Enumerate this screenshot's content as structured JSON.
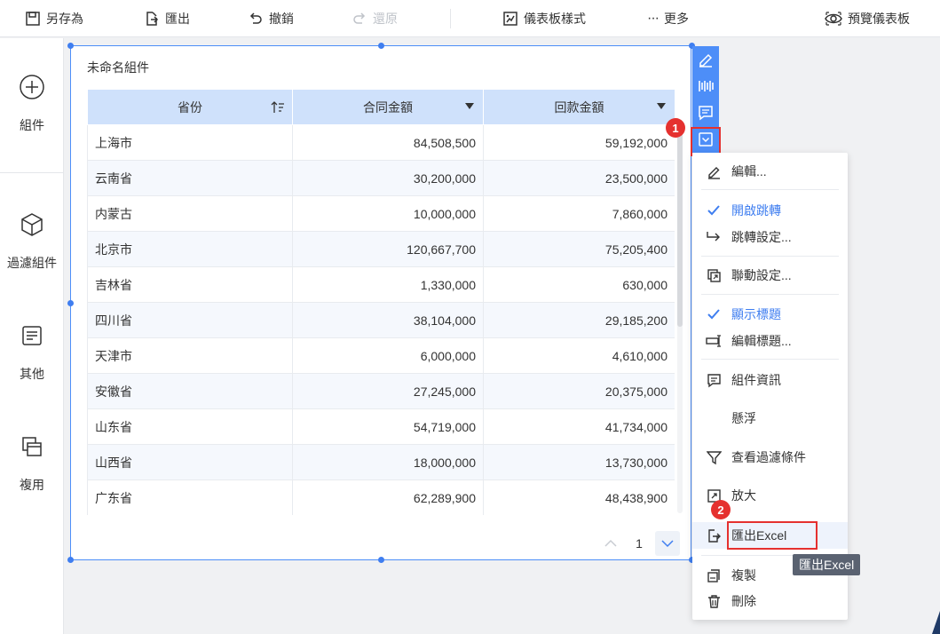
{
  "toolbar": {
    "save_as": "另存為",
    "export": "匯出",
    "undo": "撤銷",
    "redo": "還原",
    "dashboard_style": "儀表板樣式",
    "more": "更多",
    "preview": "預覽儀表板"
  },
  "sidebar": {
    "items": [
      {
        "label": "組件",
        "icon": "plus-circle-icon"
      },
      {
        "label": "過濾組件",
        "icon": "cube-icon"
      },
      {
        "label": "其他",
        "icon": "document-icon"
      },
      {
        "label": "複用",
        "icon": "copy-icon"
      }
    ]
  },
  "widget": {
    "title": "未命名組件",
    "columns": [
      "省份",
      "合同金額",
      "回款金額"
    ],
    "rows": [
      [
        "上海市",
        "84,508,500",
        "59,192,000"
      ],
      [
        "云南省",
        "30,200,000",
        "23,500,000"
      ],
      [
        "内蒙古",
        "10,000,000",
        "7,860,000"
      ],
      [
        "北京市",
        "120,667,700",
        "75,205,400"
      ],
      [
        "吉林省",
        "1,330,000",
        "630,000"
      ],
      [
        "四川省",
        "38,104,000",
        "29,185,200"
      ],
      [
        "天津市",
        "6,000,000",
        "4,610,000"
      ],
      [
        "安徽省",
        "27,245,000",
        "20,375,000"
      ],
      [
        "山东省",
        "54,719,000",
        "41,734,000"
      ],
      [
        "山西省",
        "18,000,000",
        "13,730,000"
      ],
      [
        "广东省",
        "62,289,900",
        "48,438,900"
      ]
    ],
    "page": "1"
  },
  "markers": {
    "one": "1",
    "two": "2"
  },
  "menu": {
    "edit": "編輯...",
    "enable_jump": "開啟跳轉",
    "jump_settings": "跳轉設定...",
    "linkage_settings": "聯動設定...",
    "show_title": "顯示標題",
    "edit_title": "編輯標題...",
    "widget_info": "組件資訊",
    "float": "懸浮",
    "view_filter": "查看過濾條件",
    "zoom": "放大",
    "export_excel": "匯出Excel",
    "duplicate": "複製",
    "delete": "刪除"
  },
  "tooltip": "匯出Excel",
  "colors": {
    "accent": "#4d8ef8",
    "header_bg": "#cfe1fb",
    "highlight_red": "#e5312f"
  }
}
